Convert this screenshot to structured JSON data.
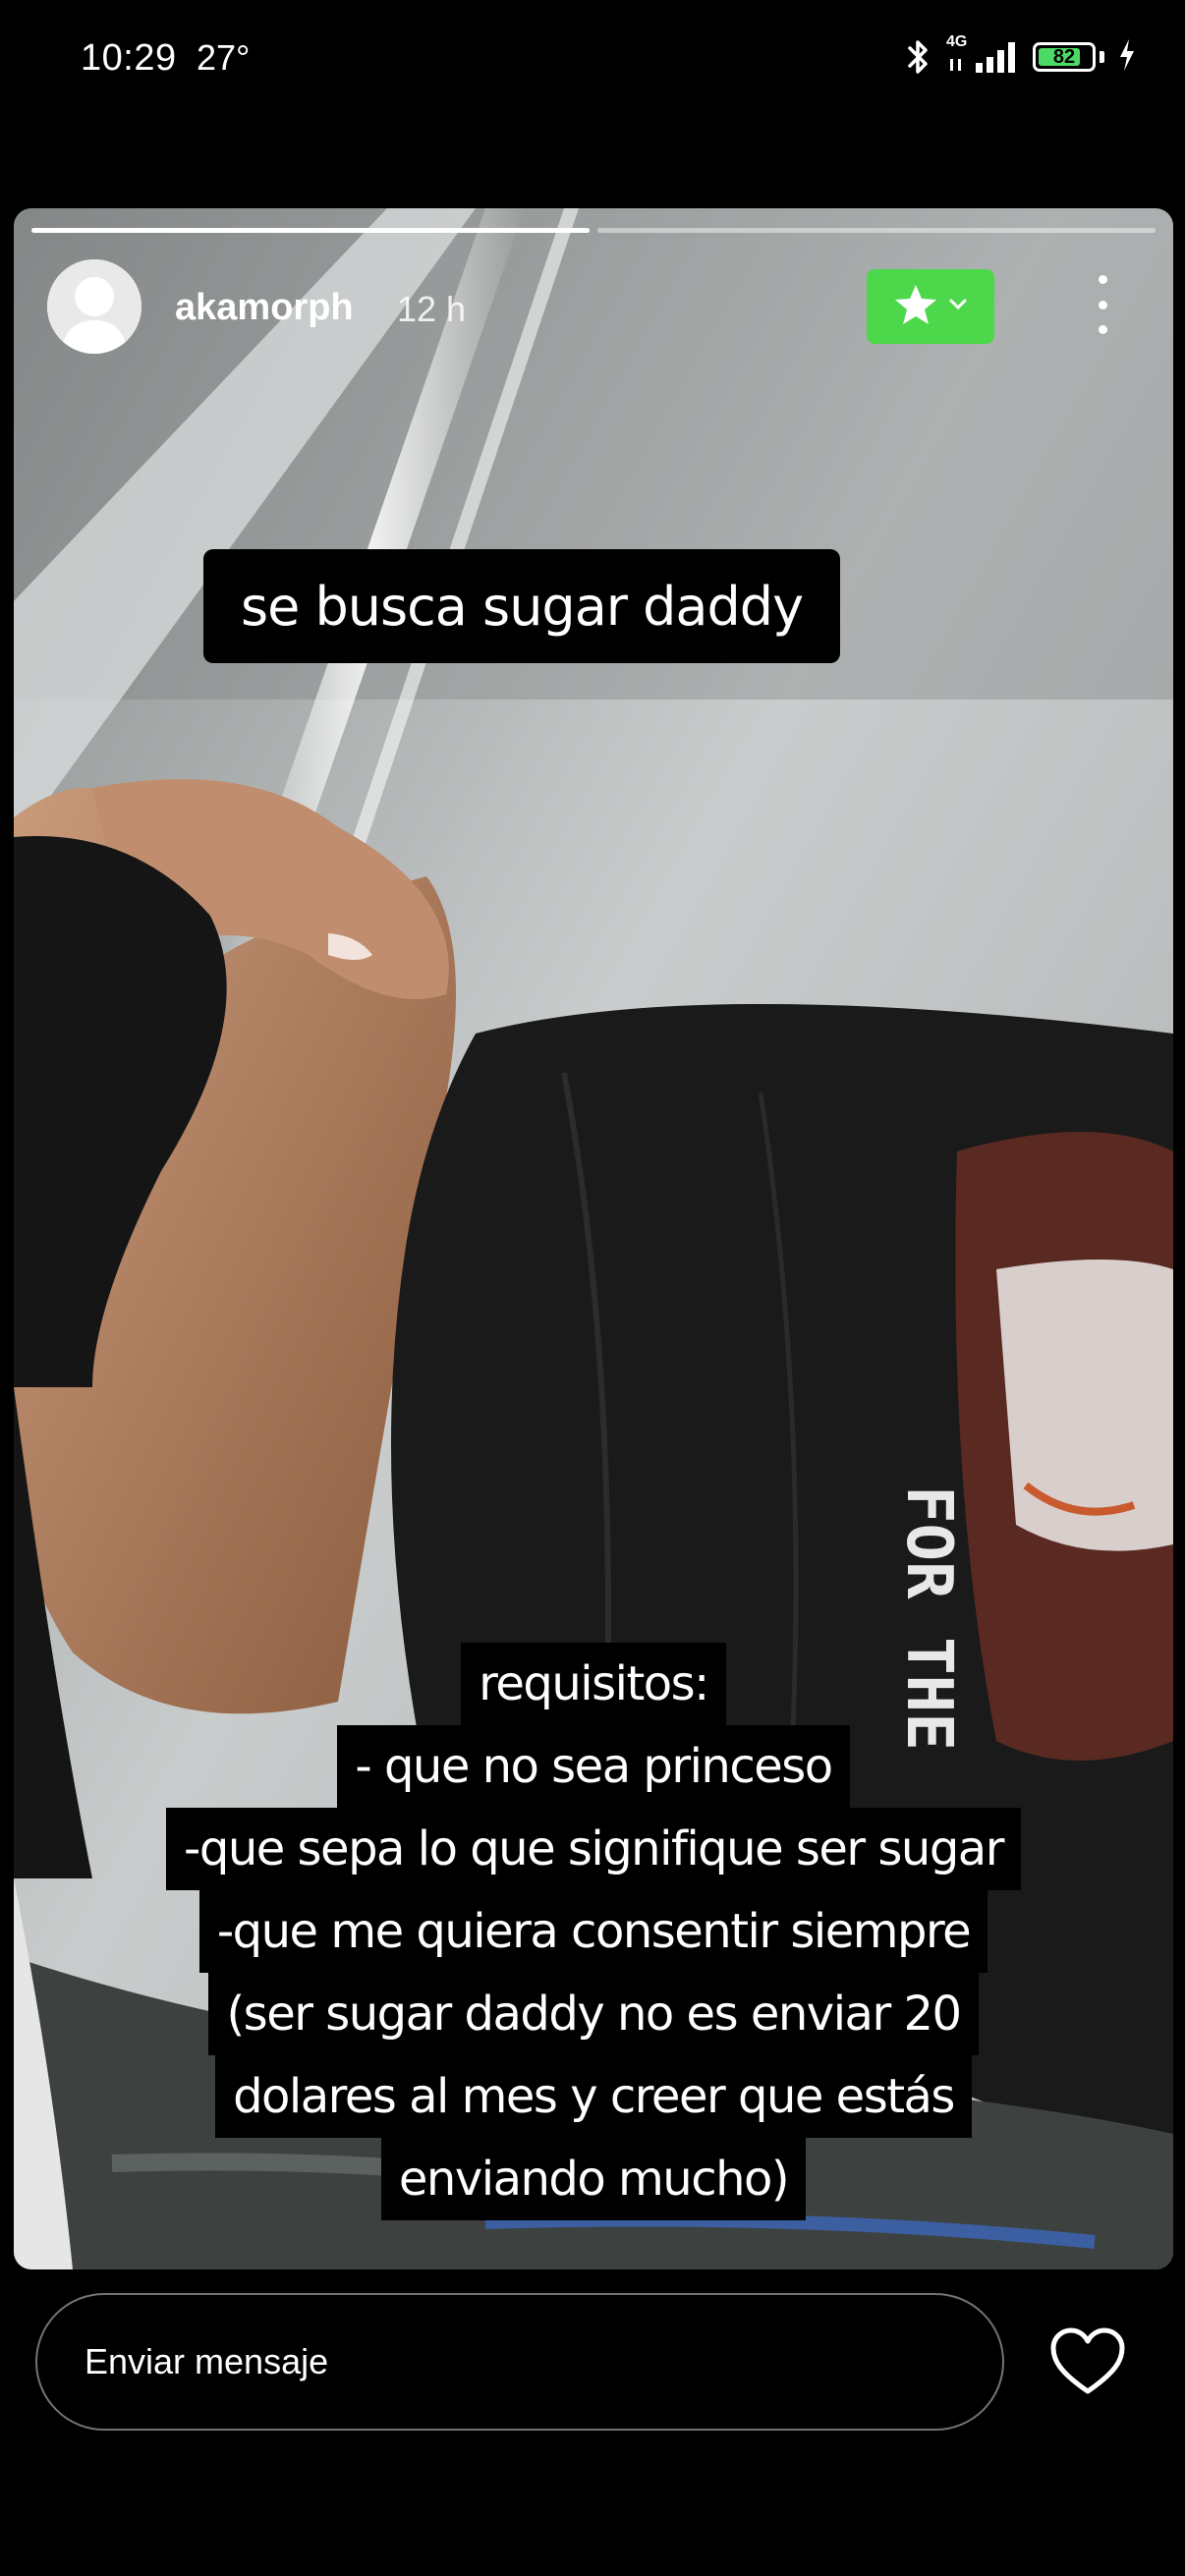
{
  "status_bar": {
    "time": "10:29",
    "temperature": "27°",
    "network": "4G",
    "battery_level": "82",
    "battery_fraction": 0.82
  },
  "story": {
    "username": "akamorph",
    "time_ago": "12 h",
    "progress_segments": [
      1.0,
      0.0
    ],
    "close_friends_icon": "star-icon",
    "caption_top": "se busca sugar daddy",
    "requirements": [
      "requisitos:",
      "- que no sea princeso",
      "-que sepa lo que signifique ser sugar",
      "-que me quiera consentir siempre",
      "(ser sugar daddy no es enviar 20",
      "dolares al mes y creer que estás",
      "enviando mucho)"
    ]
  },
  "reply": {
    "placeholder": "Enviar mensaje"
  },
  "colors": {
    "close_friends": "#4cd84a",
    "battery": "#4cd964"
  }
}
